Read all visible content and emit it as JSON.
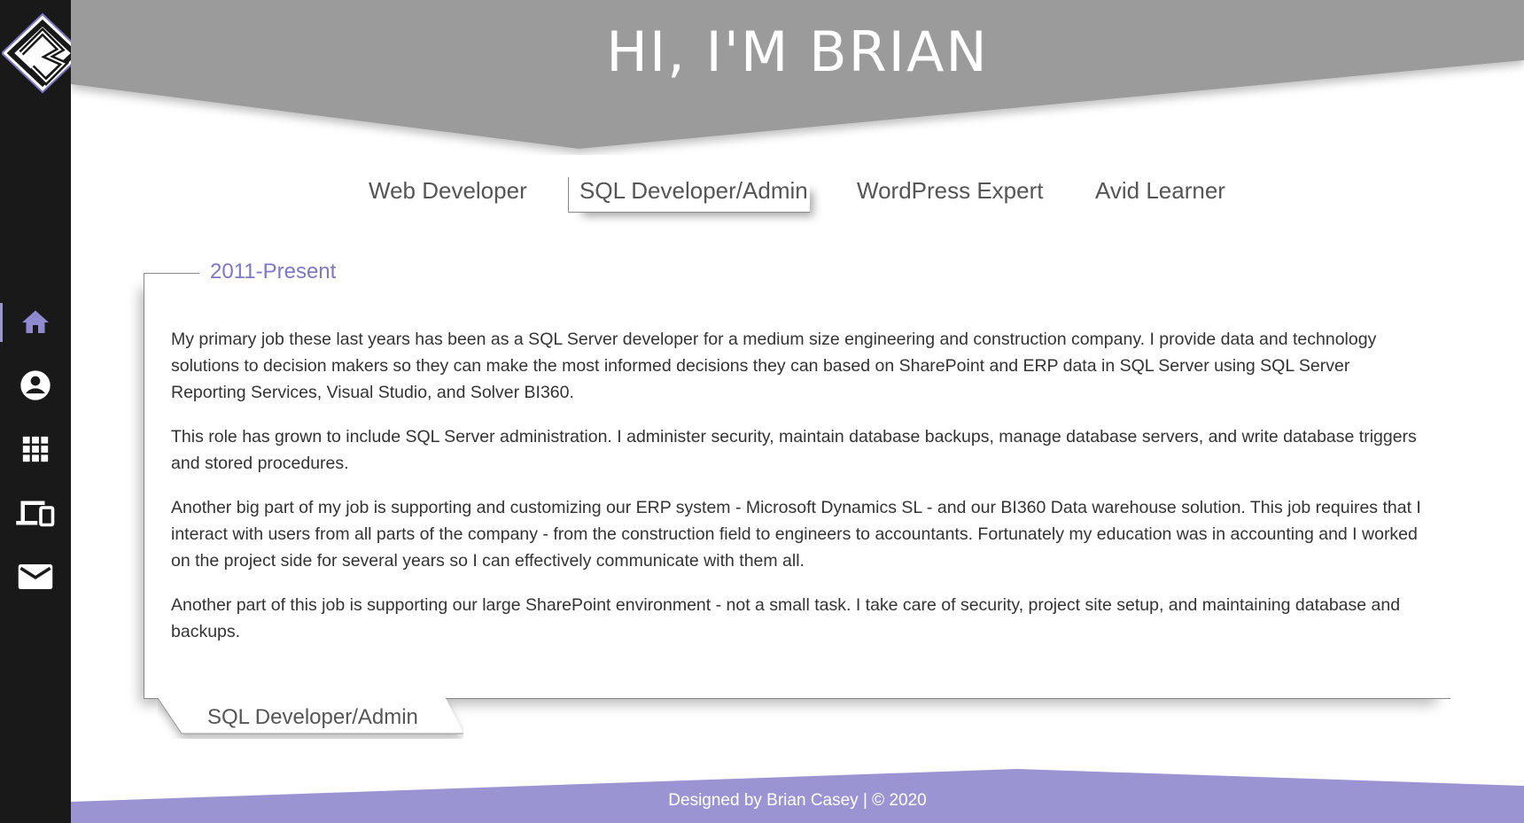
{
  "header": {
    "title": "HI, I'M BRIAN"
  },
  "sidebar": {
    "items": [
      {
        "icon": "home-icon",
        "active": true
      },
      {
        "icon": "account-icon",
        "active": false
      },
      {
        "icon": "apps-grid-icon",
        "active": false
      },
      {
        "icon": "devices-icon",
        "active": false
      },
      {
        "icon": "mail-icon",
        "active": false
      }
    ]
  },
  "tabs": [
    {
      "label": "Web Developer",
      "active": false
    },
    {
      "label": "SQL Developer/Admin",
      "active": true
    },
    {
      "label": "WordPress Expert",
      "active": false
    },
    {
      "label": "Avid Learner",
      "active": false
    }
  ],
  "card": {
    "period": "2011-Present",
    "paragraphs": [
      "My primary job these last years has been as a SQL Server developer for a medium size engineering and construction company. I provide data and technology solutions to decision makers so they can make the most informed decisions they can based on SharePoint and ERP data in SQL Server using SQL Server Reporting Services, Visual Studio, and Solver BI360.",
      "This role has grown to include SQL Server administration. I administer security, maintain database backups, manage database servers, and write database triggers and stored procedures.",
      "Another big part of my job is supporting and customizing our ERP system - Microsoft Dynamics SL - and our BI360 Data warehouse solution. This job requires that I interact with users from all parts of the company - from the construction field to engineers to accountants. Fortunately my education was in accounting and I worked on the project side for several years so I can effectively communicate with them all.",
      "Another part of this job is supporting our large SharePoint environment - not a small task. I take care of security, project site setup, and maintaining database and backups."
    ],
    "footer_label": "SQL Developer/Admin"
  },
  "footer": {
    "text": "Designed by Brian Casey | © 2020"
  },
  "colors": {
    "sidebar_bg": "#191919",
    "header_bg": "#9b9b9b",
    "accent": "#9a95d2",
    "footer_bg": "#9a95d2"
  }
}
